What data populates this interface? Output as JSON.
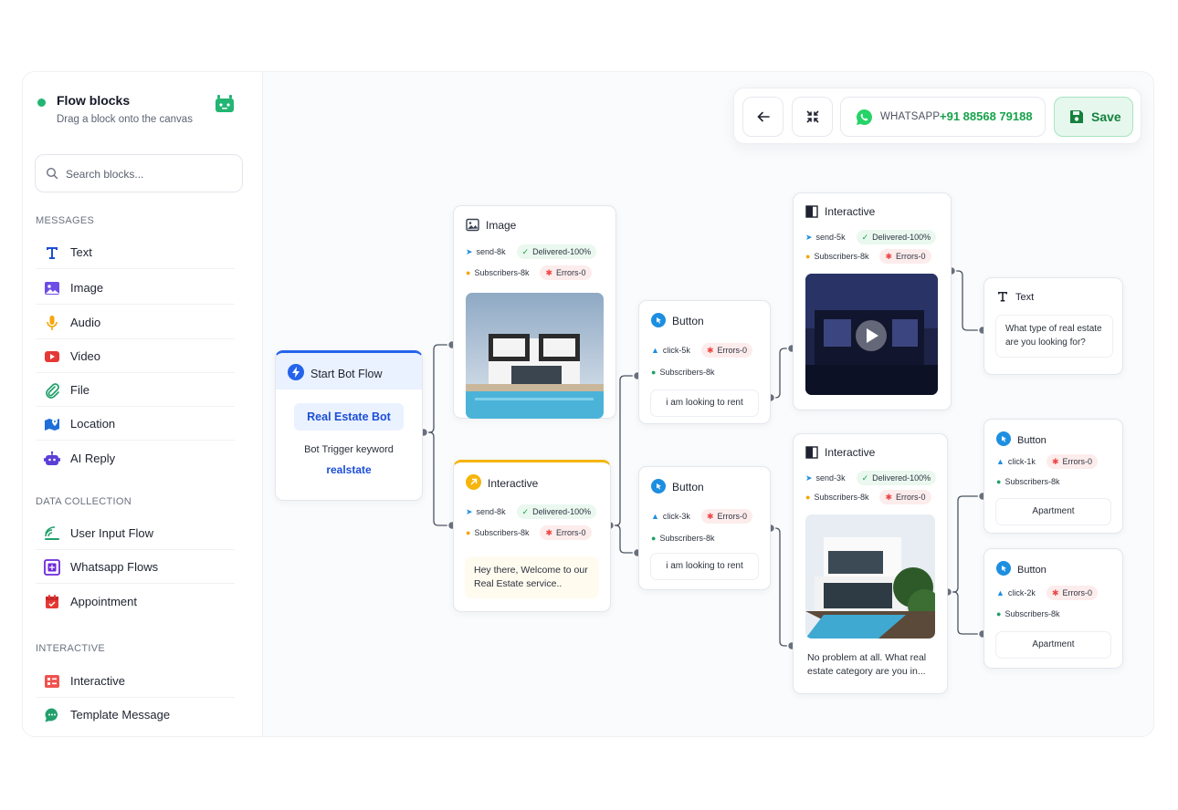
{
  "sidebar": {
    "title": "Flow blocks",
    "subtitle": "Drag a block onto the canvas",
    "search_placeholder": "Search blocks...",
    "sections": [
      {
        "heading": "MESSAGES",
        "items": [
          "Text",
          "Image",
          "Audio",
          "Video",
          "File",
          "Location",
          "AI Reply"
        ]
      },
      {
        "heading": "DATA COLLECTION",
        "items": [
          "User Input Flow",
          "Whatsapp Flows",
          "Appointment"
        ]
      },
      {
        "heading": "INTERACTIVE",
        "items": [
          "Interactive",
          "Template Message"
        ]
      }
    ]
  },
  "toolbar": {
    "whatsapp_label": "WHATSAPP",
    "phone": "+91 88568 79188",
    "save_label": "Save"
  },
  "nodes": {
    "start": {
      "title": "Start Bot Flow",
      "bot_name": "Real Estate Bot",
      "keyword_label": "Bot Trigger keyword",
      "keyword": "realstate"
    },
    "image1": {
      "title": "Image",
      "send": "send-8k",
      "delivered": "Delivered-100%",
      "subscribers": "Subscribers-8k",
      "errors": "Errors-0"
    },
    "interactive1": {
      "title": "Interactive",
      "send": "send-8k",
      "delivered": "Delivered-100%",
      "subscribers": "Subscribers-8k",
      "errors": "Errors-0",
      "message": "Hey there, Welcome to our Real Estate service.."
    },
    "button1": {
      "title": "Button",
      "click": "click-5k",
      "errors": "Errors-0",
      "subscribers": "Subscribers-8k",
      "button": "i am looking to rent"
    },
    "button2": {
      "title": "Button",
      "click": "click-3k",
      "errors": "Errors-0",
      "subscribers": "Subscribers-8k",
      "button": "i am looking to rent"
    },
    "interactive2": {
      "title": "Interactive",
      "send": "send-5k",
      "delivered": "Delivered-100%",
      "subscribers": "Subscribers-8k",
      "errors": "Errors-0"
    },
    "interactive3": {
      "title": "Interactive",
      "send": "send-3k",
      "delivered": "Delivered-100%",
      "subscribers": "Subscribers-8k",
      "errors": "Errors-0",
      "message": "No problem at all. What real estate category are you in..."
    },
    "text1": {
      "title": "Text",
      "message": "What type of real estate are you looking for?"
    },
    "button3": {
      "title": "Button",
      "click": "click-1k",
      "errors": "Errors-0",
      "subscribers": "Subscribers-8k",
      "button": "Apartment"
    },
    "button4": {
      "title": "Button",
      "click": "click-2k",
      "errors": "Errors-0",
      "subscribers": "Subscribers-8k",
      "button": "Apartment"
    }
  },
  "colors": {
    "accent_green": "#22b573",
    "start_blue": "#2563eb",
    "interactive_yellow": "#f5b50a",
    "error_red": "#ef4444"
  }
}
